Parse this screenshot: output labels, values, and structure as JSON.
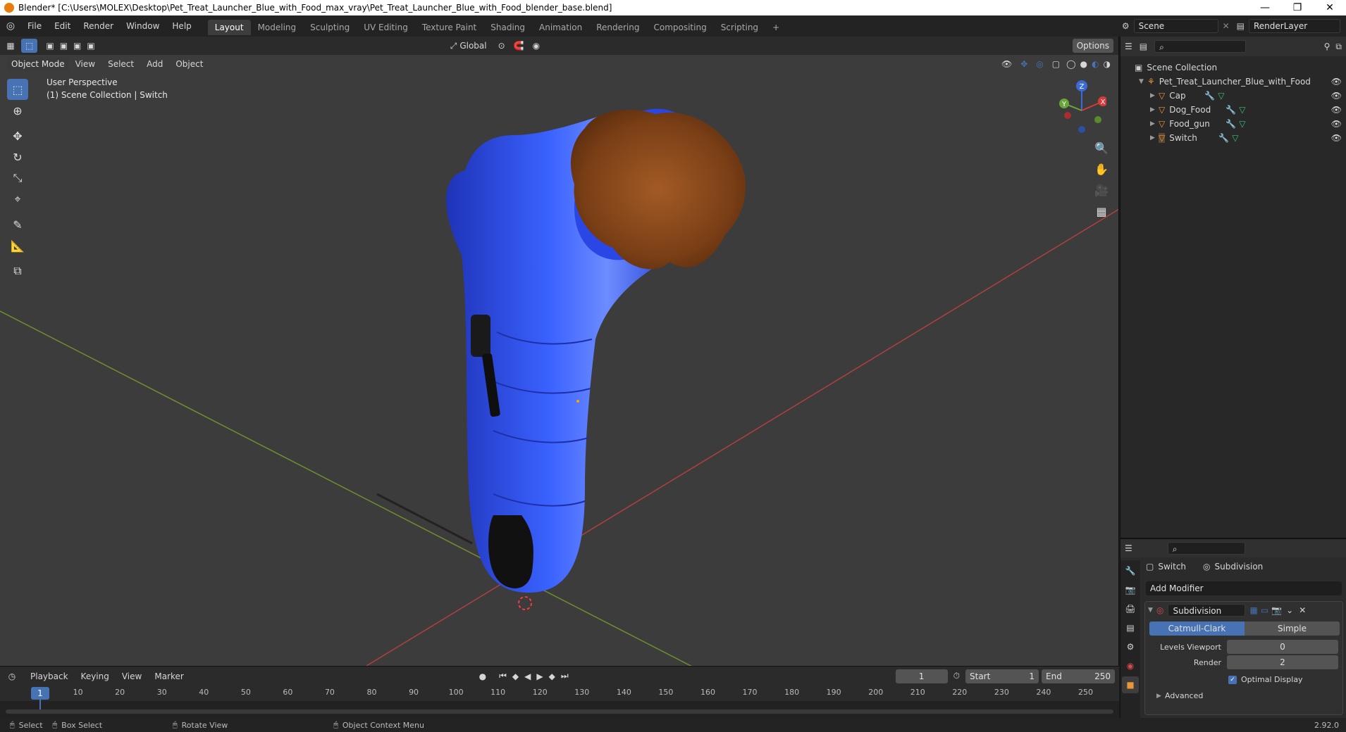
{
  "window": {
    "title": "Blender* [C:\\Users\\MOLEX\\Desktop\\Pet_Treat_Launcher_Blue_with_Food_max_vray\\Pet_Treat_Launcher_Blue_with_Food_blender_base.blend]",
    "minimize": "—",
    "restore": "❐",
    "close": "✕"
  },
  "menus": [
    "File",
    "Edit",
    "Render",
    "Window",
    "Help"
  ],
  "workspaces": [
    "Layout",
    "Modeling",
    "Sculpting",
    "UV Editing",
    "Texture Paint",
    "Shading",
    "Animation",
    "Rendering",
    "Compositing",
    "Scripting"
  ],
  "workspace_add": "+",
  "scene": {
    "name": "Scene",
    "render_layer": "RenderLayer"
  },
  "viewport": {
    "mode": "Object Mode",
    "menus": [
      "View",
      "Select",
      "Add",
      "Object"
    ],
    "orientation": "Global",
    "options": "Options",
    "overlay_title": "User Perspective",
    "overlay_subtitle": "(1) Scene Collection | Switch",
    "gizmo": {
      "z": "Z",
      "y": "Y",
      "x": "X"
    }
  },
  "outliner": {
    "root": "Scene Collection",
    "collection": "Pet_Treat_Launcher_Blue_with_Food",
    "objects": [
      "Cap",
      "Dog_Food",
      "Food_gun",
      "Switch"
    ]
  },
  "properties": {
    "object": "Switch",
    "modifier_tab": "Subdivision",
    "add_modifier": "Add Modifier",
    "modifier_name": "Subdivision",
    "algo_options": [
      "Catmull-Clark",
      "Simple"
    ],
    "levels_viewport_label": "Levels Viewport",
    "levels_viewport": "0",
    "render_label": "Render",
    "render_level": "2",
    "optimal_display": "Optimal Display",
    "advanced": "Advanced"
  },
  "timeline": {
    "menus": [
      "Playback",
      "Keying",
      "View",
      "Marker"
    ],
    "current_frame": "1",
    "start_label": "Start",
    "start": "1",
    "end_label": "End",
    "end": "250",
    "ruler": [
      "1",
      "10",
      "20",
      "30",
      "40",
      "50",
      "60",
      "70",
      "80",
      "90",
      "100",
      "110",
      "120",
      "130",
      "140",
      "150",
      "160",
      "170",
      "180",
      "190",
      "200",
      "210",
      "220",
      "230",
      "240",
      "250"
    ]
  },
  "status": {
    "select": "Select",
    "box_select": "Box Select",
    "rotate_view": "Rotate View",
    "context_menu": "Object Context Menu",
    "version": "2.92.0"
  },
  "colors": {
    "accent": "#4772b3",
    "model_blue": "#2f4fe0",
    "food_brown": "#8a4a1e"
  }
}
